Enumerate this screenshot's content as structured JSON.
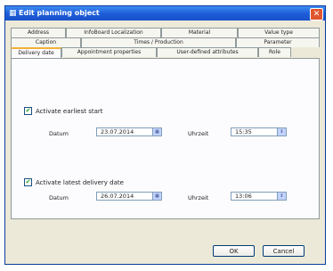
{
  "window": {
    "title": "Edit planning object",
    "app_icon": "planning-object-icon",
    "close_icon": "close-icon"
  },
  "tabs": {
    "row1": [
      "Address",
      "InfoBoard Localization",
      "Material",
      "Value type"
    ],
    "row2": [
      "Caption",
      "Times / Production",
      "Parameter"
    ],
    "row3": [
      "Delivery date",
      "Appointment properties",
      "User-defined attributes",
      "Role"
    ],
    "active": "Delivery date"
  },
  "earliest": {
    "checkbox_label": "Activate earliest start",
    "date_label": "Datum",
    "date_value": "23.07.2014",
    "time_label": "Uhrzeit",
    "time_value": "15:35"
  },
  "latest": {
    "checkbox_label": "Activate latest delivery date",
    "date_label": "Datum",
    "date_value": "26.07.2014",
    "time_label": "Uhrzeit",
    "time_value": "13:06"
  },
  "buttons": {
    "ok": "OK",
    "cancel": "Cancel"
  },
  "colors": {
    "titlebar": "#1c5bd8",
    "active_tab_accent": "#f2b13a",
    "dialog_bg": "#ece9d8"
  }
}
